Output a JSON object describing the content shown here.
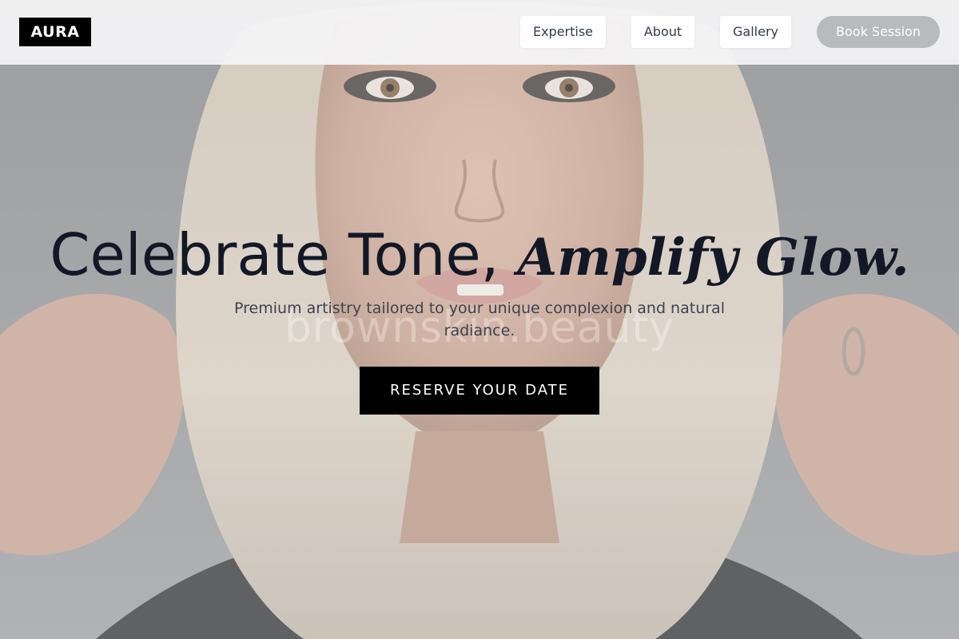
{
  "brand": {
    "logo_text": "AURA"
  },
  "nav": {
    "items": [
      {
        "label": "Expertise"
      },
      {
        "label": "About"
      },
      {
        "label": "Gallery"
      }
    ],
    "book_label": "Book Session"
  },
  "hero": {
    "headline_plain": "Celebrate Tone, ",
    "headline_accent": "Amplify Glow.",
    "subheadline": "Premium artistry tailored to your unique complexion and natural radiance.",
    "cta_label": "RESERVE YOUR DATE",
    "watermark_text": "brownskin.beauty",
    "background_image": "portrait-photo"
  },
  "colors": {
    "ink": "#121826",
    "cta_bg": "#000000",
    "book_bg": "#b9babc",
    "topbar_bg": "#f4f4f5"
  }
}
